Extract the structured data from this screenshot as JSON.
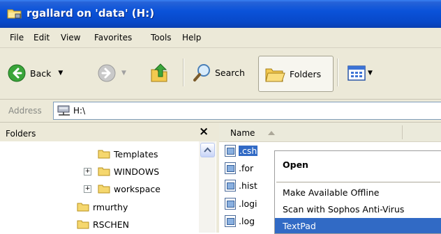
{
  "window": {
    "title": "rgallard on 'data' (H:)"
  },
  "menu": [
    "File",
    "Edit",
    "View",
    "Favorites",
    "Tools",
    "Help"
  ],
  "toolbar": {
    "back_label": "Back",
    "search_label": "Search",
    "folders_label": "Folders"
  },
  "address": {
    "label": "Address",
    "value": "H:\\"
  },
  "folders_pane": {
    "title": "Folders",
    "items": [
      {
        "label": "Templates",
        "expander": ""
      },
      {
        "label": "WINDOWS",
        "expander": "+"
      },
      {
        "label": "workspace",
        "expander": "+"
      },
      {
        "label": "rmurthy",
        "expander": ""
      },
      {
        "label": "RSCHEN",
        "expander": ""
      }
    ]
  },
  "file_list": {
    "column_name": "Name",
    "files": [
      ".csh",
      ".for",
      ".hist",
      ".logi",
      ".log"
    ]
  },
  "context_menu": {
    "items": [
      "Open",
      "Make Available Offline",
      "Scan with Sophos Anti-Virus",
      "TextPad"
    ]
  }
}
